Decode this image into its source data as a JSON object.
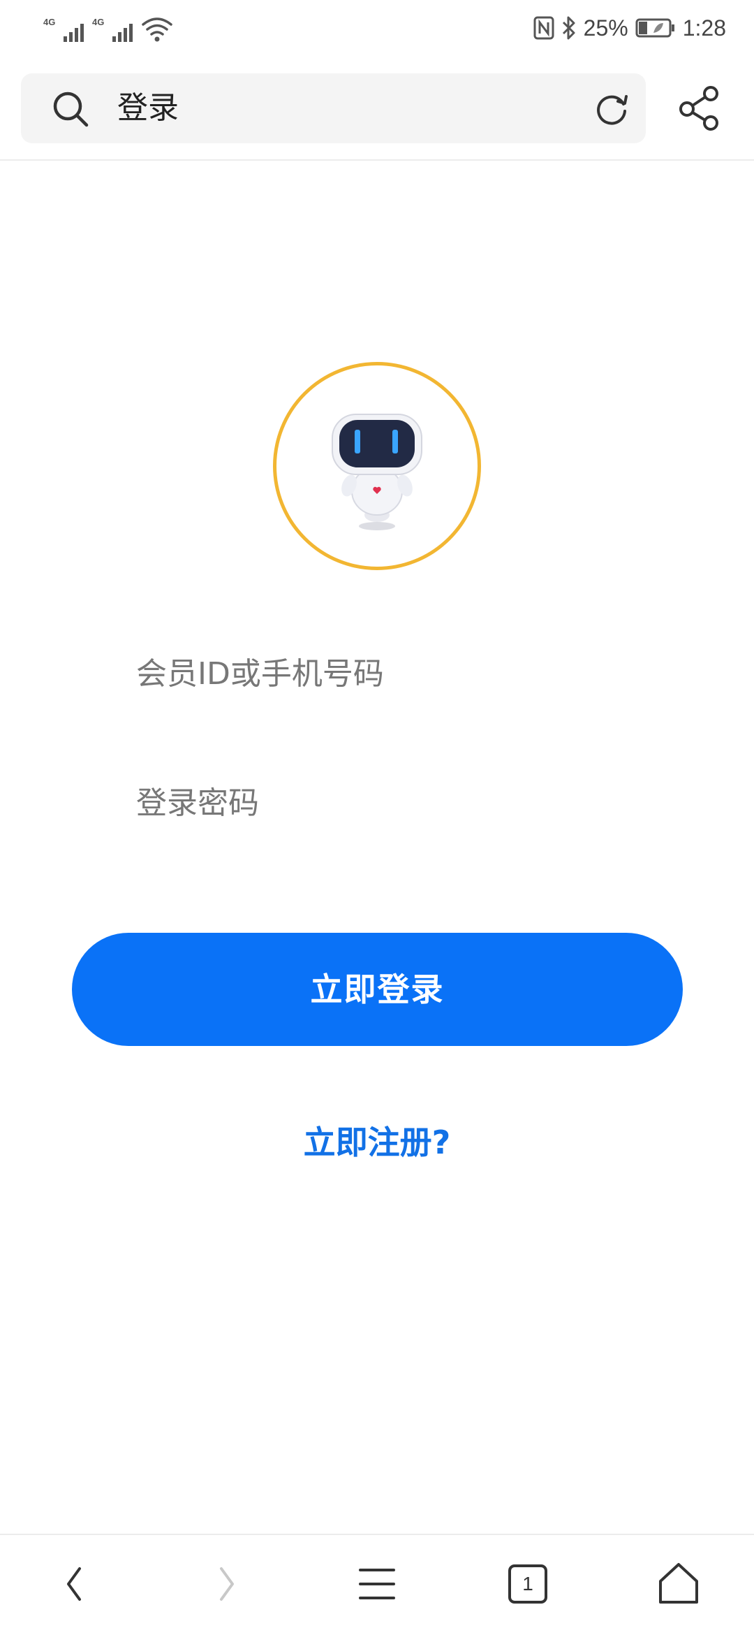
{
  "status_bar": {
    "network_1": "4G",
    "network_2": "4G",
    "battery_percent": "25%",
    "time": "1:28"
  },
  "search": {
    "query": "登录"
  },
  "form": {
    "account_placeholder": "会员ID或手机号码",
    "password_placeholder": "登录密码",
    "login_label": "立即登录",
    "register_label": "立即注册?"
  },
  "bottom_nav": {
    "tab_count": "1"
  },
  "colors": {
    "primary": "#0a72f7",
    "link": "#1271e6",
    "avatar_ring": "#f2b632"
  },
  "icons": [
    "search-icon",
    "refresh-icon",
    "share-icon",
    "back-icon",
    "forward-icon",
    "menu-icon",
    "tabs-icon",
    "home-icon"
  ]
}
